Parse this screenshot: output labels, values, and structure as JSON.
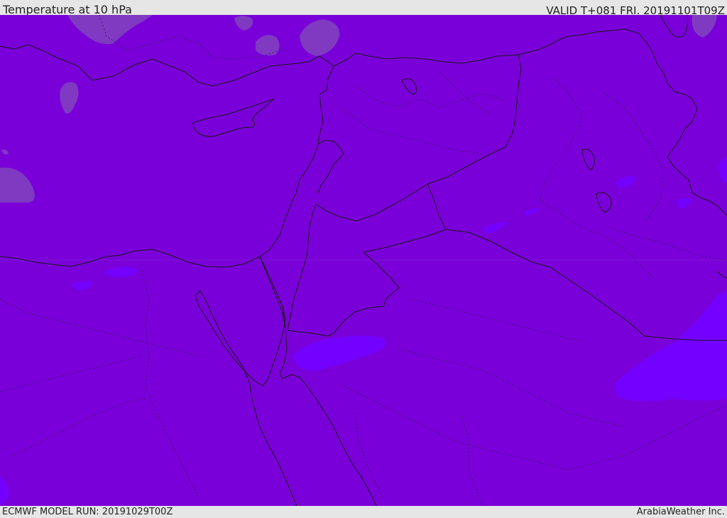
{
  "header": {
    "title": "Temperature at 10 hPa",
    "valid": "VALID T+081 FRI. 20191101T09Z"
  },
  "footer": {
    "model_run": "ECMWF MODEL RUN: 20191029T00Z",
    "credit": "ArabiaWeather Inc."
  },
  "map": {
    "field_colors": {
      "base": "#7a00d9",
      "warmer_patch": "#7f3ac1",
      "colder_patch": "#7400ff"
    },
    "line_colors": {
      "coastline": "#1a1a1a",
      "borders": "#1a1a1a",
      "subdivisions": "#4a2a7a"
    }
  }
}
